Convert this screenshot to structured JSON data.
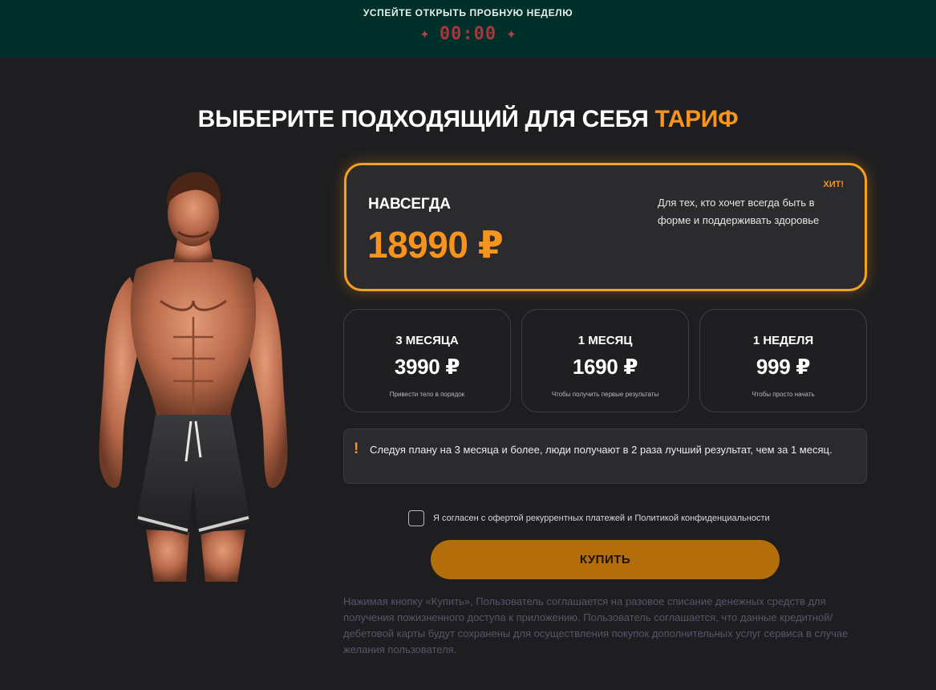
{
  "promo": {
    "title": "УСПЕЙТЕ ОТКРЫТЬ ПРОБНУЮ НЕДЕЛЮ",
    "timer": "00:00"
  },
  "heading": {
    "main": "ВЫБЕРИТЕ ПОДХОДЯЩИЙ ДЛЯ СЕБЯ ",
    "accent": "ТАРИФ"
  },
  "featured_plan": {
    "badge": "ХИТ!",
    "name": "НАВСЕГДА",
    "price": "18990 ₽",
    "description": "Для тех, кто хочет всегда быть в форме и поддерживать здоровье"
  },
  "plans": [
    {
      "name": "3 МЕСЯЦА",
      "price": "3990 ₽",
      "note": "Привести тело в порядок"
    },
    {
      "name": "1 МЕСЯЦ",
      "price": "1690 ₽",
      "note": "Чтобы получить первые результаты"
    },
    {
      "name": "1 НЕДЕЛЯ",
      "price": "999 ₽",
      "note": "Чтобы просто начать"
    }
  ],
  "notice": {
    "icon": "!",
    "text": "Следуя плану на 3 месяца и более, люди получают в 2 раза лучший результат, чем за 1 месяц."
  },
  "consent": {
    "checked": false,
    "text": "Я согласен с офертой рекуррентных платежей и Политикой конфиденциальности"
  },
  "buy_button": {
    "label": "КУПИТЬ"
  },
  "legal_text": "Нажимая кнопку «Купить», Пользователь соглашается на разовое списание денежных средств для получения пожизненного доступа к приложению. Пользователь соглашается, что данные кредитной/дебетовой карты будут сохранены для осуществления покупок дополнительных услуг сервиса в случае желания пользователя.",
  "colors": {
    "accent": "#f7941d",
    "background": "#1e1e20",
    "promo_bar": "#01302a",
    "timer": "#a8363f",
    "button": "#b36d0b"
  },
  "icons": {
    "spark_left": "sparkle-icon",
    "spark_right": "sparkle-icon",
    "notice": "exclamation-icon"
  }
}
